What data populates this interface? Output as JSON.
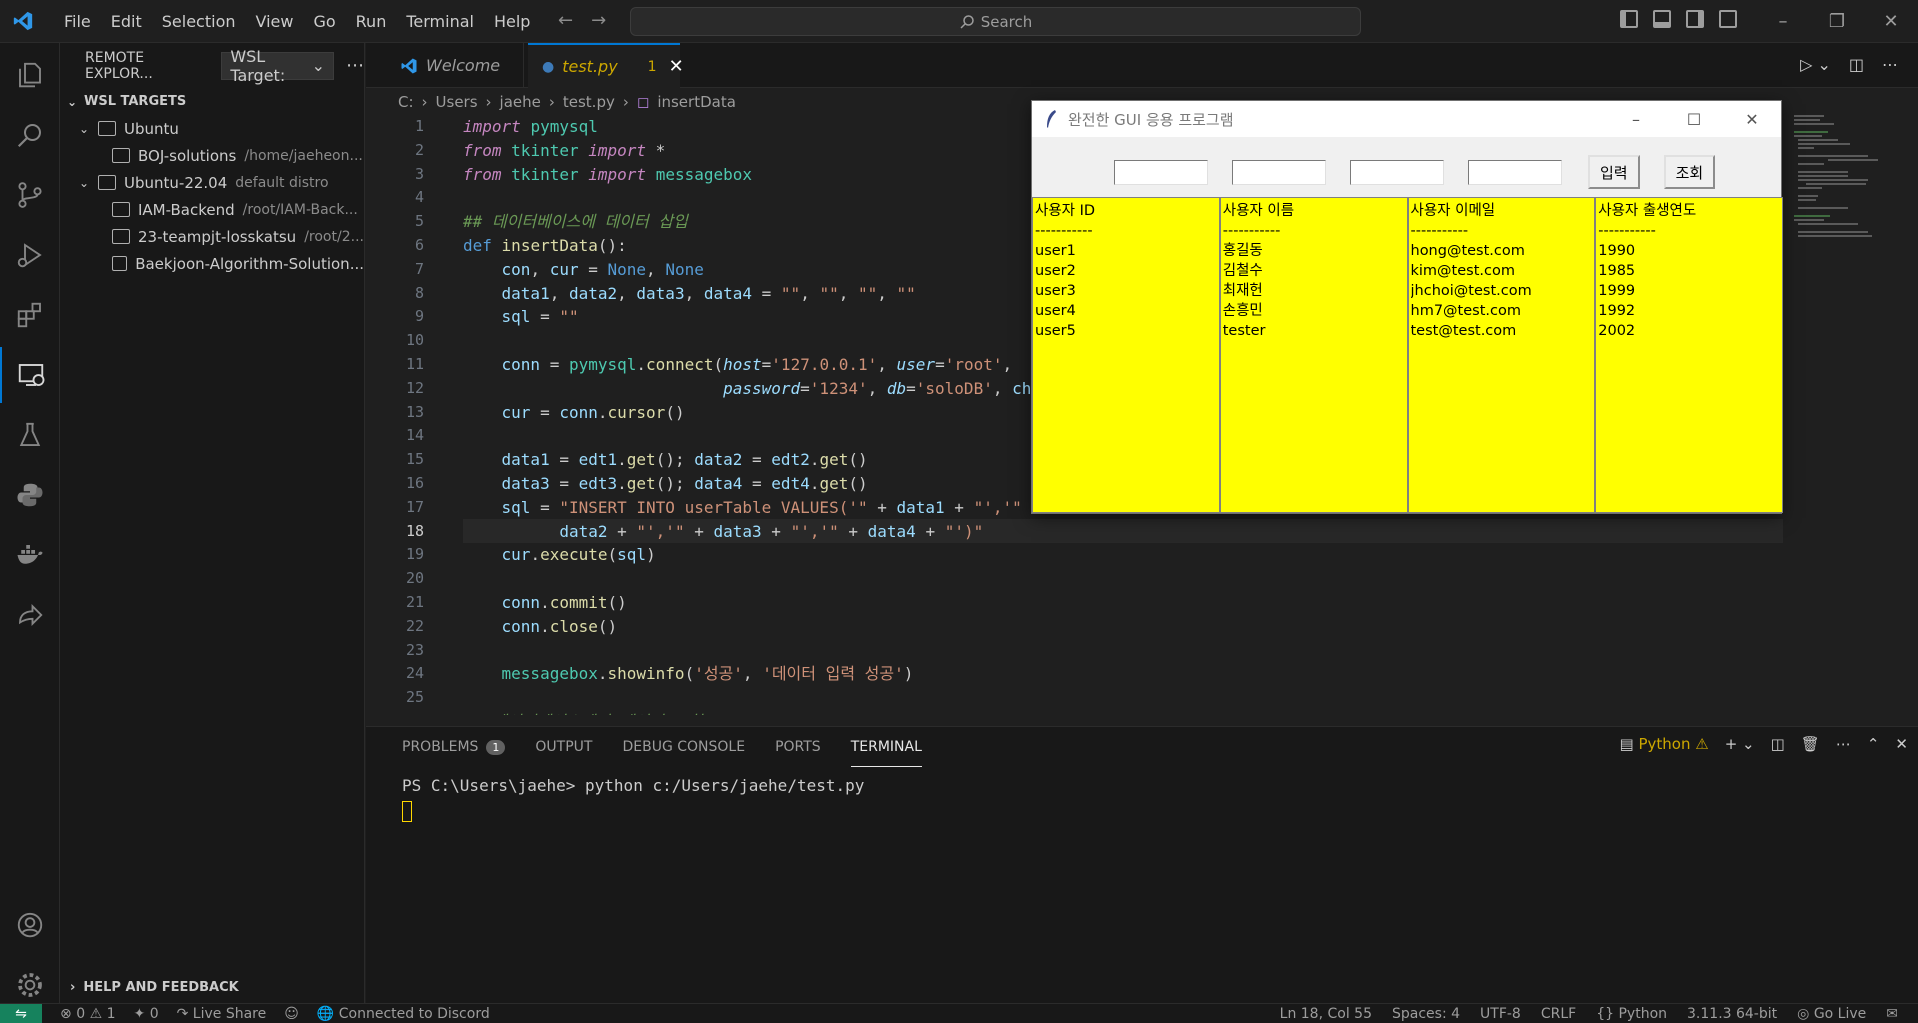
{
  "menu": [
    "File",
    "Edit",
    "Selection",
    "View",
    "Go",
    "Run",
    "Terminal",
    "Help"
  ],
  "search": {
    "placeholder": "Search"
  },
  "sidebar": {
    "title": "REMOTE EXPLOR...",
    "target_select": "WSL Target:",
    "section": "WSL TARGETS",
    "items": [
      {
        "label": "Ubuntu",
        "desc": ""
      },
      {
        "label": "BOJ-solutions",
        "desc": "/home/jaeheon..."
      },
      {
        "label": "Ubuntu-22.04",
        "desc": "default distro"
      },
      {
        "label": "IAM-Backend",
        "desc": "/root/IAM-Back..."
      },
      {
        "label": "23-teampjt-losskatsu",
        "desc": "/root/2..."
      },
      {
        "label": "Baekjoon-Algorithm-Solution...",
        "desc": ""
      }
    ],
    "help": "HELP AND FEEDBACK"
  },
  "tabs": {
    "welcome": "Welcome",
    "test": "test.py",
    "test_badge": "1"
  },
  "breadcrumb": [
    "C:",
    "Users",
    "jaehe",
    "test.py",
    "insertData"
  ],
  "editor": {
    "current_line": 18,
    "lines": [
      "import pymysql",
      "from tkinter import *",
      "from tkinter import messagebox",
      "",
      "## 데이터베이스에 데이터 삽입",
      "def insertData():",
      "    con, cur = None, None",
      "    data1, data2, data3, data4 = \"\", \"\", \"\", \"\"",
      "    sql = \"\"",
      "",
      "    conn = pymysql.connect(host='127.0.0.1', user='root',",
      "                           password='1234', db='soloDB', ch",
      "    cur = conn.cursor()",
      "",
      "    data1 = edt1.get(); data2 = edt2.get()",
      "    data3 = edt3.get(); data4 = edt4.get()",
      "    sql = \"INSERT INTO userTable VALUES('\" + data1 + \"','\"",
      "          data2 + \"','\" + data3 + \"','\" + data4 + \"')\"",
      "    cur.execute(sql)",
      "",
      "    conn.commit()",
      "    conn.close()",
      "",
      "    messagebox.showinfo('성공', '데이터 입력 성공')",
      "",
      "## 데이터베이스에서 데이터 조회"
    ]
  },
  "tk_window": {
    "title": "완전한 GUI 응용 프로그램",
    "btn_insert": "입력",
    "btn_query": "조회",
    "columns": [
      {
        "header": "사용자 ID",
        "sep": "-----------",
        "rows": [
          "user1",
          "user2",
          "user3",
          "user4",
          "user5"
        ]
      },
      {
        "header": "사용자 이름",
        "sep": "-----------",
        "rows": [
          "홍길동",
          "김철수",
          "최재헌",
          "손흥민",
          "tester"
        ]
      },
      {
        "header": "사용자 이메일",
        "sep": "-----------",
        "rows": [
          "hong@test.com",
          "kim@test.com",
          "jhchoi@test.com",
          "hm7@test.com",
          "test@test.com"
        ]
      },
      {
        "header": "사용자 출생연도",
        "sep": "-----------",
        "rows": [
          "1990",
          "1985",
          "1999",
          "1992",
          "2002"
        ]
      }
    ]
  },
  "panel": {
    "tabs": [
      "PROBLEMS",
      "OUTPUT",
      "DEBUG CONSOLE",
      "PORTS",
      "TERMINAL"
    ],
    "problems_badge": "1",
    "shell_label": "Python",
    "terminal_line": "PS C:\\Users\\jaehe> python c:/Users/jaehe/test.py"
  },
  "status": {
    "errors": "0",
    "warnings": "1",
    "ports": "0",
    "live_share": "Live Share",
    "discord": "Connected to Discord",
    "position": "Ln 18, Col 55",
    "spaces": "Spaces: 4",
    "encoding": "UTF-8",
    "eol": "CRLF",
    "language": "Python",
    "interpreter": "3.11.3 64-bit",
    "golive": "Go Live"
  },
  "colors": {
    "accent": "#0078d4",
    "remote": "#16825d",
    "tk_cells": "#ffff00"
  }
}
